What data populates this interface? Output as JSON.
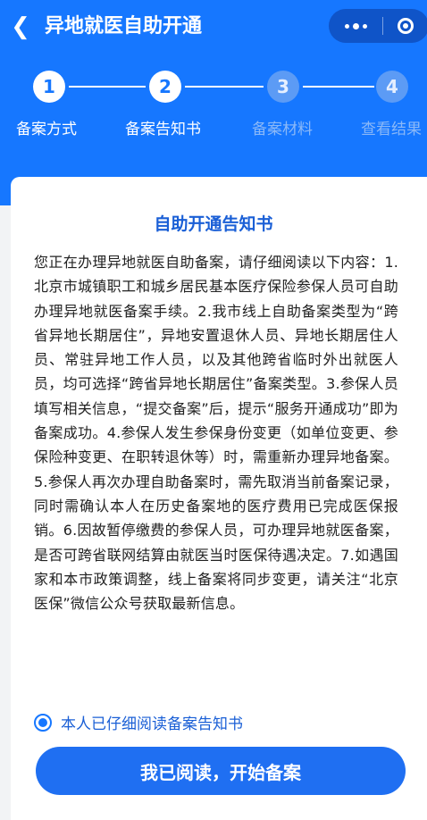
{
  "colors": {
    "primary": "#1677ff",
    "header_bg": "#1677ff",
    "title_text": "#1a5fd6"
  },
  "header": {
    "back_icon": "chevron-left-icon",
    "title": "异地就医自助开通",
    "capsule": {
      "more_icon": "more-dots-icon",
      "close_icon": "target-close-icon"
    }
  },
  "steps": [
    {
      "number": "1",
      "label": "备案方式",
      "active": true
    },
    {
      "number": "2",
      "label": "备案告知书",
      "active": true
    },
    {
      "number": "3",
      "label": "备案材料",
      "active": false
    },
    {
      "number": "4",
      "label": "查看结果",
      "active": false
    }
  ],
  "card": {
    "title": "自助开通告知书",
    "body": "您正在办理异地就医自助备案，请仔细阅读以下内容：1.北京市城镇职工和城乡居民基本医疗保险参保人员可自助办理异地就医备案手续。2.我市线上自助备案类型为“跨省异地长期居住”，异地安置退休人员、异地长期居住人员、常驻异地工作人员，以及其他跨省临时外出就医人员，均可选择“跨省异地长期居住”备案类型。3.参保人员填写相关信息，“提交备案”后，提示“服务开通成功”即为备案成功。4.参保人发生参保身份变更（如单位变更、参保险种变更、在职转退休等）时，需重新办理异地备案。5.参保人再次办理自助备案时，需先取消当前备案记录，同时需确认本人在历史备案地的医疗费用已完成医保报销。6.因故暂停缴费的参保人员，可办理异地就医备案，是否可跨省联网结算由就医当时医保待遇决定。7.如遇国家和本市政策调整，线上备案将同步变更，请关注“北京医保”微信公众号获取最新信息。",
    "agree_label": "本人已仔细阅读备案告知书",
    "agree_checked": true,
    "start_button": "我已阅读，开始备案"
  }
}
